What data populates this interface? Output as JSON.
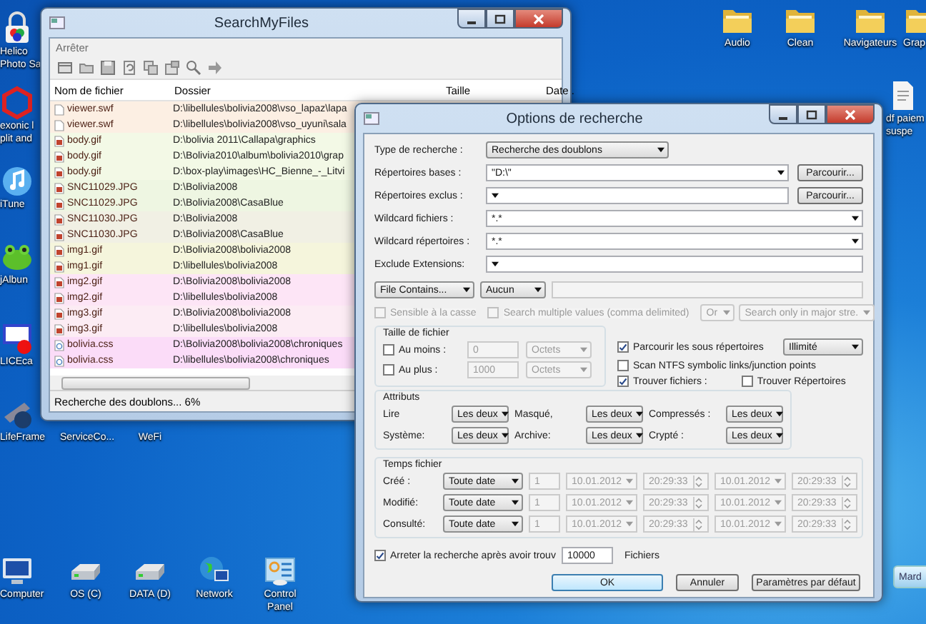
{
  "desktop_icons": [
    {
      "lines": [
        "Helico",
        "Photo Sa"
      ]
    },
    {
      "lines": [
        "exonic l",
        "plit and"
      ]
    },
    {
      "lines": [
        "iTune"
      ]
    },
    {
      "lines": [
        "jAlbun"
      ]
    },
    {
      "lines": [
        "LICEca"
      ]
    },
    {
      "lines": [
        "LifeFrame"
      ]
    },
    {
      "lines": [
        "ServiceCo..."
      ]
    },
    {
      "lines": [
        "WeFi"
      ]
    },
    {
      "lines": [
        "Computer"
      ]
    },
    {
      "lines": [
        "OS (C)"
      ]
    },
    {
      "lines": [
        "DATA (D)"
      ]
    },
    {
      "lines": [
        "Network"
      ]
    },
    {
      "lines": [
        "Control",
        "Panel"
      ]
    },
    {
      "lines": [
        "Audio"
      ]
    },
    {
      "lines": [
        "Clean"
      ]
    },
    {
      "lines": [
        "Navigateurs"
      ]
    },
    {
      "lines": [
        "Grap"
      ]
    },
    {
      "lines": [
        "df paiem",
        "suspe"
      ]
    }
  ],
  "gadget": {
    "label": "Mard"
  },
  "search_window": {
    "title": "SearchMyFiles",
    "menu": [
      "Arrêter"
    ],
    "columns": [
      "Nom de fichier",
      "Dossier",
      "Taille",
      "Date ."
    ],
    "rows": [
      {
        "kind": "document",
        "name": "viewer.swf",
        "folder": "D:\\libellules\\bolivia2008\\vso_lapaz\\lapa",
        "color": "#fcefe3"
      },
      {
        "kind": "document",
        "name": "viewer.swf",
        "folder": "D:\\libellules\\bolivia2008\\vso_uyuni\\sala",
        "color": "#fcefe3"
      },
      {
        "kind": "image",
        "name": "body.gif",
        "folder": "D:\\bolivia 2011\\Callapa\\graphics",
        "color": "#f3f9e6"
      },
      {
        "kind": "image",
        "name": "body.gif",
        "folder": "D:\\Bolivia2010\\album\\bolivia2010\\grap",
        "color": "#f3f9e6"
      },
      {
        "kind": "image",
        "name": "body.gif",
        "folder": "D:\\box-play\\images\\HC_Bienne_-_Litvi",
        "color": "#f3f9e6"
      },
      {
        "kind": "image",
        "name": "SNC11029.JPG",
        "folder": "D:\\Bolivia2008",
        "color": "#eef6e2"
      },
      {
        "kind": "image",
        "name": "SNC11029.JPG",
        "folder": "D:\\Bolivia2008\\CasaBlue",
        "color": "#eef6e2"
      },
      {
        "kind": "image",
        "name": "SNC11030.JPG",
        "folder": "D:\\Bolivia2008",
        "color": "#f1f0e4"
      },
      {
        "kind": "image",
        "name": "SNC11030.JPG",
        "folder": "D:\\Bolivia2008\\CasaBlue",
        "color": "#f1f0e4"
      },
      {
        "kind": "image",
        "name": "img1.gif",
        "folder": "D:\\Bolivia2008\\bolivia2008",
        "color": "#f5f5dc"
      },
      {
        "kind": "image",
        "name": "img1.gif",
        "folder": "D:\\libellules\\bolivia2008",
        "color": "#f5f5dc"
      },
      {
        "kind": "image",
        "name": "img2.gif",
        "folder": "D:\\Bolivia2008\\bolivia2008",
        "color": "#fde5f6"
      },
      {
        "kind": "image",
        "name": "img2.gif",
        "folder": "D:\\libellules\\bolivia2008",
        "color": "#fde5f6"
      },
      {
        "kind": "image",
        "name": "img3.gif",
        "folder": "D:\\Bolivia2008\\bolivia2008",
        "color": "#fcecf4"
      },
      {
        "kind": "image",
        "name": "img3.gif",
        "folder": "D:\\libellules\\bolivia2008",
        "color": "#fcecf4"
      },
      {
        "kind": "stylesheet",
        "name": "bolivia.css",
        "folder": "D:\\Bolivia2008\\bolivia2008\\chroniques",
        "color": "#fbdcf8"
      },
      {
        "kind": "stylesheet",
        "name": "bolivia.css",
        "folder": "D:\\libellules\\bolivia2008\\chroniques",
        "color": "#fbdcf8"
      }
    ],
    "status": "Recherche des doublons... 6%"
  },
  "options_dialog": {
    "title": "Options de recherche",
    "search_type": {
      "label": "Type de recherche :",
      "value": "Recherche des doublons"
    },
    "path_fields": [
      {
        "label": "Répertoires bases :",
        "value": "\"D:\\\"",
        "button": "Parcourir..."
      },
      {
        "label": "Répertoires exclus :",
        "button": "Parcourir..."
      },
      {
        "label": "Wildcard fichiers :",
        "value": "*.*"
      },
      {
        "label": "Wildcard répertoires :",
        "value": "*.*"
      },
      {
        "label": "Exclude Extensions:"
      }
    ],
    "contains": {
      "mode": "File Contains...",
      "encoding": "Aucun"
    },
    "case_sensitive": {
      "label": "Sensible à la casse",
      "checked": false,
      "disabled": true
    },
    "multiple_values": {
      "label": "Search multiple values (comma delimited)",
      "checked": false,
      "disabled": true
    },
    "operator": "Or",
    "scope": "Search only in major stre.",
    "size": {
      "title": "Taille de fichier",
      "rows": [
        {
          "label": "Au moins :",
          "checked": false,
          "value": "0",
          "unit": "Octets",
          "disabled": true
        },
        {
          "label": "Au plus :",
          "checked": false,
          "value": "1000",
          "unit": "Octets",
          "disabled": true
        }
      ]
    },
    "options": [
      {
        "label": "Parcourir les sous répertoires",
        "checked": true
      },
      {
        "label": "Scan NTFS symbolic links/junction points",
        "checked": false
      },
      {
        "label": "Trouver fichiers :",
        "checked": true
      },
      {
        "label": "Trouver Répertoires",
        "checked": false
      }
    ],
    "depth": "Illimité",
    "attributes": {
      "title": "Attributs",
      "items": [
        {
          "label": "Lire",
          "value": "Les deux"
        },
        {
          "label": "Masqué,",
          "value": "Les deux"
        },
        {
          "label": "Compressés :",
          "value": "Les deux"
        },
        {
          "label": "Système:",
          "value": "Les deux"
        },
        {
          "label": "Archive:",
          "value": "Les deux"
        },
        {
          "label": "Crypté :",
          "value": "Les deux"
        }
      ]
    },
    "times": {
      "title": "Temps fichier",
      "rows": [
        {
          "label": "Créé :",
          "mode": "Toute date",
          "count": "1",
          "from_date": "10.01.2012",
          "from_time": "20:29:33",
          "to_date": "10.01.2012",
          "to_time": "20:29:33",
          "disabled": true
        },
        {
          "label": "Modifié:",
          "mode": "Toute date",
          "count": "1",
          "from_date": "10.01.2012",
          "from_time": "20:29:33",
          "to_date": "10.01.2012",
          "to_time": "20:29:33",
          "disabled": true
        },
        {
          "label": "Consulté:",
          "mode": "Toute date",
          "count": "1",
          "from_date": "10.01.2012",
          "from_time": "20:29:33",
          "to_date": "10.01.2012",
          "to_time": "20:29:33",
          "disabled": true
        }
      ]
    },
    "stop": {
      "label": "Arreter la recherche après avoir trouv",
      "checked": true,
      "value": "10000",
      "unit": "Fichiers"
    },
    "buttons": [
      {
        "label": "OK",
        "default": true
      },
      {
        "label": "Annuler",
        "default": false
      },
      {
        "label": "Paramètres par défaut",
        "default": false
      }
    ]
  }
}
